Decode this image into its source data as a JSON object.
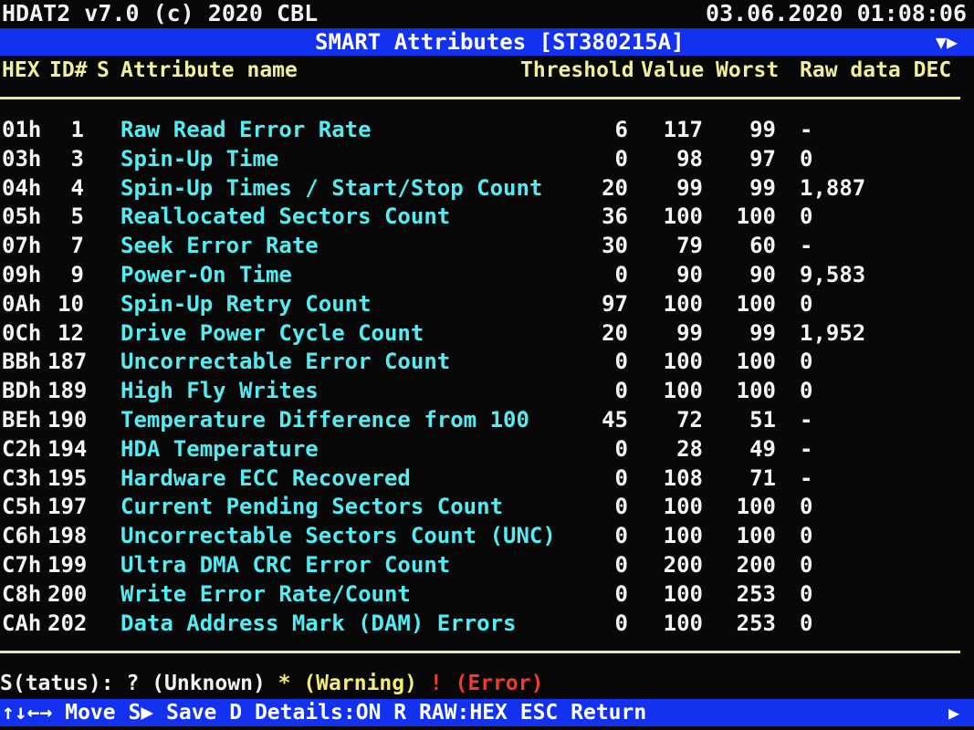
{
  "header": {
    "app_title": "HDAT2 v7.0 (c) 2020 CBL",
    "datetime": "03.06.2020 01:08:06"
  },
  "title_bar": {
    "title": "SMART Attributes [ST380215A]",
    "scroll_indicator": "▼▶"
  },
  "columns": {
    "hex": "HEX",
    "id": "ID#",
    "status": "S",
    "name": "Attribute name",
    "threshold": "Threshold",
    "value": "Value",
    "worst": "Worst",
    "raw": "Raw data DEC"
  },
  "rows": [
    {
      "hex": "01h",
      "id": "1",
      "status": "",
      "name": "Raw Read Error Rate",
      "threshold": "6",
      "value": "117",
      "worst": "99",
      "raw": "-"
    },
    {
      "hex": "03h",
      "id": "3",
      "status": "",
      "name": "Spin-Up Time",
      "threshold": "0",
      "value": "98",
      "worst": "97",
      "raw": "0"
    },
    {
      "hex": "04h",
      "id": "4",
      "status": "",
      "name": "Spin-Up Times / Start/Stop Count",
      "threshold": "20",
      "value": "99",
      "worst": "99",
      "raw": "1,887"
    },
    {
      "hex": "05h",
      "id": "5",
      "status": "",
      "name": "Reallocated Sectors Count",
      "threshold": "36",
      "value": "100",
      "worst": "100",
      "raw": "0"
    },
    {
      "hex": "07h",
      "id": "7",
      "status": "",
      "name": "Seek Error Rate",
      "threshold": "30",
      "value": "79",
      "worst": "60",
      "raw": "-"
    },
    {
      "hex": "09h",
      "id": "9",
      "status": "",
      "name": "Power-On Time",
      "threshold": "0",
      "value": "90",
      "worst": "90",
      "raw": "9,583"
    },
    {
      "hex": "0Ah",
      "id": "10",
      "status": "",
      "name": "Spin-Up Retry Count",
      "threshold": "97",
      "value": "100",
      "worst": "100",
      "raw": "0"
    },
    {
      "hex": "0Ch",
      "id": "12",
      "status": "",
      "name": "Drive Power Cycle Count",
      "threshold": "20",
      "value": "99",
      "worst": "99",
      "raw": "1,952"
    },
    {
      "hex": "BBh",
      "id": "187",
      "status": "",
      "name": "Uncorrectable Error Count",
      "threshold": "0",
      "value": "100",
      "worst": "100",
      "raw": "0"
    },
    {
      "hex": "BDh",
      "id": "189",
      "status": "",
      "name": "High Fly Writes",
      "threshold": "0",
      "value": "100",
      "worst": "100",
      "raw": "0"
    },
    {
      "hex": "BEh",
      "id": "190",
      "status": "",
      "name": "Temperature Difference from 100",
      "threshold": "45",
      "value": "72",
      "worst": "51",
      "raw": "-"
    },
    {
      "hex": "C2h",
      "id": "194",
      "status": "",
      "name": "HDA Temperature",
      "threshold": "0",
      "value": "28",
      "worst": "49",
      "raw": "-"
    },
    {
      "hex": "C3h",
      "id": "195",
      "status": "",
      "name": "Hardware ECC Recovered",
      "threshold": "0",
      "value": "108",
      "worst": "71",
      "raw": "-"
    },
    {
      "hex": "C5h",
      "id": "197",
      "status": "",
      "name": "Current Pending Sectors Count",
      "threshold": "0",
      "value": "100",
      "worst": "100",
      "raw": "0"
    },
    {
      "hex": "C6h",
      "id": "198",
      "status": "",
      "name": "Uncorrectable Sectors Count (UNC)",
      "threshold": "0",
      "value": "100",
      "worst": "100",
      "raw": "0"
    },
    {
      "hex": "C7h",
      "id": "199",
      "status": "",
      "name": "Ultra DMA CRC Error Count",
      "threshold": "0",
      "value": "200",
      "worst": "200",
      "raw": "0"
    },
    {
      "hex": "C8h",
      "id": "200",
      "status": "",
      "name": "Write Error Rate/Count",
      "threshold": "0",
      "value": "100",
      "worst": "253",
      "raw": "0"
    },
    {
      "hex": "CAh",
      "id": "202",
      "status": "",
      "name": "Data Address Mark (DAM) Errors",
      "threshold": "0",
      "value": "100",
      "worst": "253",
      "raw": "0"
    }
  ],
  "legend": {
    "prefix": "S(tatus): ? (Unknown) ",
    "warning": "* (Warning) ",
    "error": "! (Error)"
  },
  "status_bar": {
    "keys": "↑↓←→ Move S▶ Save D Details:ON R RAW:HEX ESC Return",
    "arrow": "▶"
  },
  "colors": {
    "background": "#070807",
    "bar": "#1232f0",
    "header_text": "#f1ef9a",
    "attribute_name": "#54ecf2",
    "warning": "#f2ee70",
    "error": "#f03c28"
  }
}
